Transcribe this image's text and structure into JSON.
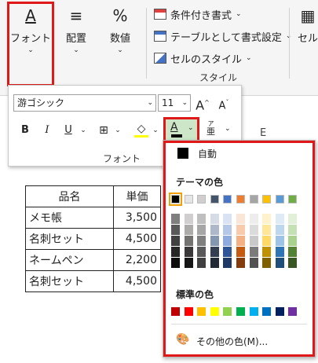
{
  "ribbon": {
    "font_btn": {
      "label": "フォント",
      "icon": "font-icon",
      "glyph": "A"
    },
    "align_btn": {
      "label": "配置",
      "icon": "align-icon",
      "glyph": "≡"
    },
    "number_btn": {
      "label": "数値",
      "icon": "percent-icon",
      "glyph": "%"
    },
    "styles": {
      "conditional": "条件付き書式",
      "table_format": "テーブルとして書式設定",
      "cell_styles": "セルのスタイル",
      "group_label": "スタイル"
    },
    "cell_label": "セル"
  },
  "font_panel": {
    "font_name": "游ゴシック",
    "font_size": "11",
    "grow": "A",
    "shrink": "A",
    "bold": "B",
    "italic": "I",
    "underline": "U",
    "font_color_glyph": "A",
    "phonetic_top": "ア",
    "phonetic_bottom": "亜",
    "group_label": "フォント"
  },
  "sheet": {
    "col_e": "E",
    "headers": [
      "品名",
      "単価"
    ],
    "rows": [
      [
        "メモ帳",
        "3,500"
      ],
      [
        "名刺セット",
        "4,500"
      ],
      [
        "ネームペン",
        "2,200"
      ],
      [
        "名刺セット",
        "4,500"
      ]
    ]
  },
  "palette": {
    "auto_label": "自動",
    "theme_title": "テーマの色",
    "standard_title": "標準の色",
    "more_colors": "その他の色(M)...",
    "theme_colors": [
      "#000000",
      "#e7e6e6",
      "#d0cece",
      "#44546a",
      "#4472c4",
      "#ed7d31",
      "#a5a5a5",
      "#ffc000",
      "#5b9bd5",
      "#70ad47"
    ],
    "theme_tints": [
      [
        "#7f7f7f",
        "#595959",
        "#404040",
        "#262626",
        "#0d0d0d"
      ],
      [
        "#d0cece",
        "#aeaaaa",
        "#767171",
        "#3a3838",
        "#171616"
      ],
      [
        "#bfbfbf",
        "#a6a6a6",
        "#7f7f7f",
        "#595959",
        "#404040"
      ],
      [
        "#d6dce5",
        "#adb9ca",
        "#8497b0",
        "#333f50",
        "#222a35"
      ],
      [
        "#dae3f3",
        "#b4c7e7",
        "#8faadc",
        "#2f5597",
        "#203864"
      ],
      [
        "#fbe5d6",
        "#f8cbad",
        "#f4b183",
        "#c55a11",
        "#843c0c"
      ],
      [
        "#ededed",
        "#dbdbdb",
        "#c9c9c9",
        "#7b7b7b",
        "#525252"
      ],
      [
        "#fff2cc",
        "#ffe699",
        "#ffd966",
        "#bf9000",
        "#7f6000"
      ],
      [
        "#deebf7",
        "#bdd7ee",
        "#9dc3e6",
        "#2e75b6",
        "#1f4e79"
      ],
      [
        "#e2f0d9",
        "#c5e0b4",
        "#a9d18e",
        "#548235",
        "#385723"
      ]
    ],
    "standard_colors": [
      "#c00000",
      "#ff0000",
      "#ffc000",
      "#ffff00",
      "#92d050",
      "#00b050",
      "#00b0f0",
      "#0070c0",
      "#002060",
      "#7030a0"
    ]
  }
}
